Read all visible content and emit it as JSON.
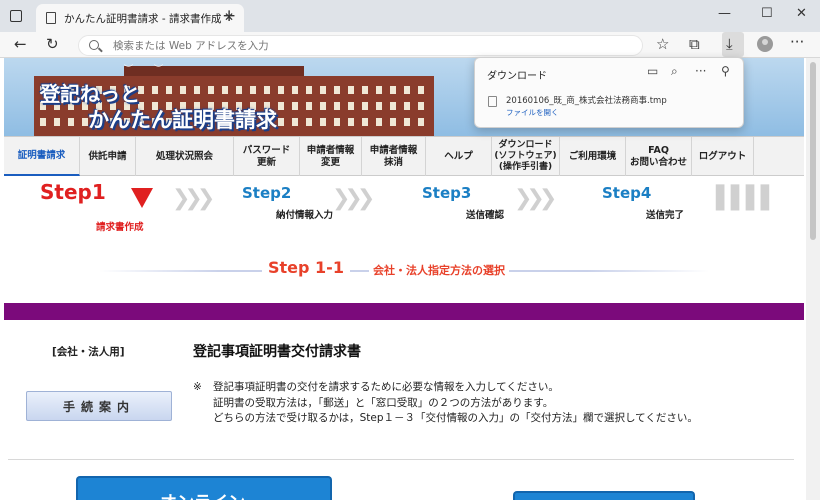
{
  "browser": {
    "tab_title": "かんたん証明書請求 - 請求書作成",
    "tab_close": "✕",
    "new_tab": "+",
    "window_controls": {
      "minimize": "—",
      "maximize": "☐",
      "close": "✕"
    },
    "nav": {
      "back": "←",
      "reload": "↻"
    },
    "address_placeholder": "検索または Web アドレスを入力",
    "toolbar_icons": [
      "favorites-star-icon",
      "collections-icon",
      "download-icon",
      "profile-avatar-icon",
      "more-menu-icon"
    ],
    "toolbar_glyphs": {
      "favorites": "☆",
      "collections": "⧉",
      "download": "⤓",
      "more": "···"
    }
  },
  "downloads": {
    "title": "ダウンロード",
    "icons": {
      "folder": "▭",
      "search": "⌕",
      "more": "···",
      "pin": "⚲"
    },
    "file_name": "20160106_既_商_株式会社法務商事.tmp",
    "open_link": "ファイルを開く"
  },
  "banner": {
    "logo_line1": "登記ねっと",
    "logo_line2": "かんたん証明書請求"
  },
  "navbar": {
    "items": [
      {
        "label": "証明書請求",
        "active": true
      },
      {
        "label": "供託申請"
      },
      {
        "label": "処理状況照会"
      },
      {
        "label": "パスワード\n更新"
      },
      {
        "label": "申請者情報\n変更"
      },
      {
        "label": "申請者情報\n抹消"
      },
      {
        "label": "ヘルプ"
      },
      {
        "label": "ダウンロード\n(ソフトウェア)\n(操作手引書)"
      },
      {
        "label": "ご利用環境"
      },
      {
        "label": "FAQ\nお問い合わせ"
      },
      {
        "label": "ログアウト"
      }
    ]
  },
  "steps": [
    {
      "label": "Step1",
      "sub": "請求書作成",
      "current": true
    },
    {
      "label": "Step2",
      "sub": "納付情報入力"
    },
    {
      "label": "Step3",
      "sub": "送信確認"
    },
    {
      "label": "Step4",
      "sub": "送信完了"
    }
  ],
  "section": {
    "step": "Step 1-1",
    "name": "会社・法人指定方法の選択"
  },
  "form": {
    "category": "[会社・法人用]",
    "title": "登記事項証明書交付請求書",
    "guide_button": "手続案内",
    "note_mark": "※",
    "notes": [
      "登記事項証明書の交付を請求するために必要な情報を入力してください。",
      "証明書の受取方法は，「郵送」と「窓口受取」の２つの方法があります。",
      "どちらの方法で受け取るかは，Step１－３「交付情報の入力」の「交付方法」欄で選択してください。"
    ],
    "online_button": "オンライン"
  },
  "colors": {
    "accent_blue": "#1d84d4",
    "step_red": "#e02020",
    "section_red": "#e8412a",
    "purple_bar": "#7b0a7b"
  }
}
